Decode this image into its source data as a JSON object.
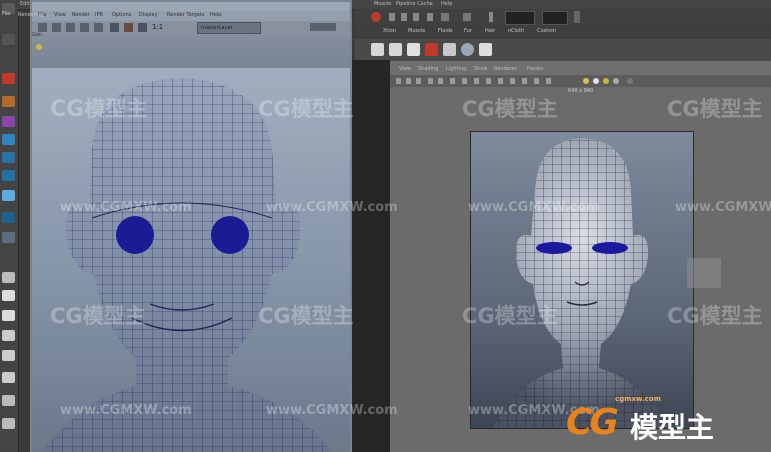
{
  "app_menu": {
    "file": "File",
    "edit": "Edit"
  },
  "top_menu": [
    "Muscle",
    "Pipeline Cache",
    "Help"
  ],
  "render_window": {
    "menu": [
      "File",
      "View",
      "Render",
      "IPR",
      "Options",
      "Display",
      "Render Targets",
      "Help"
    ],
    "toolbar": {
      "ratio": "1:1",
      "layer": "masterLayer"
    },
    "side_labels": [
      "Gen",
      "Rendering"
    ]
  },
  "shelf": {
    "tabs": [
      "Xtion",
      "Muscle",
      "Fluids",
      "Fur",
      "Hair",
      "nCloth",
      "Custom"
    ]
  },
  "viewport_menu": [
    "View",
    "Shading",
    "Lighting",
    "Show",
    "Renderer",
    "Panels"
  ],
  "resolution": "640 x 960",
  "watermark": {
    "brand": "模型主",
    "url": "www.CGMXW.com",
    "url_small": "cgmxw.com"
  },
  "colors": {
    "eye_blue": "#1b1a9c",
    "wire_dark": "#1e2358",
    "logo_orange": "#e8821c"
  }
}
